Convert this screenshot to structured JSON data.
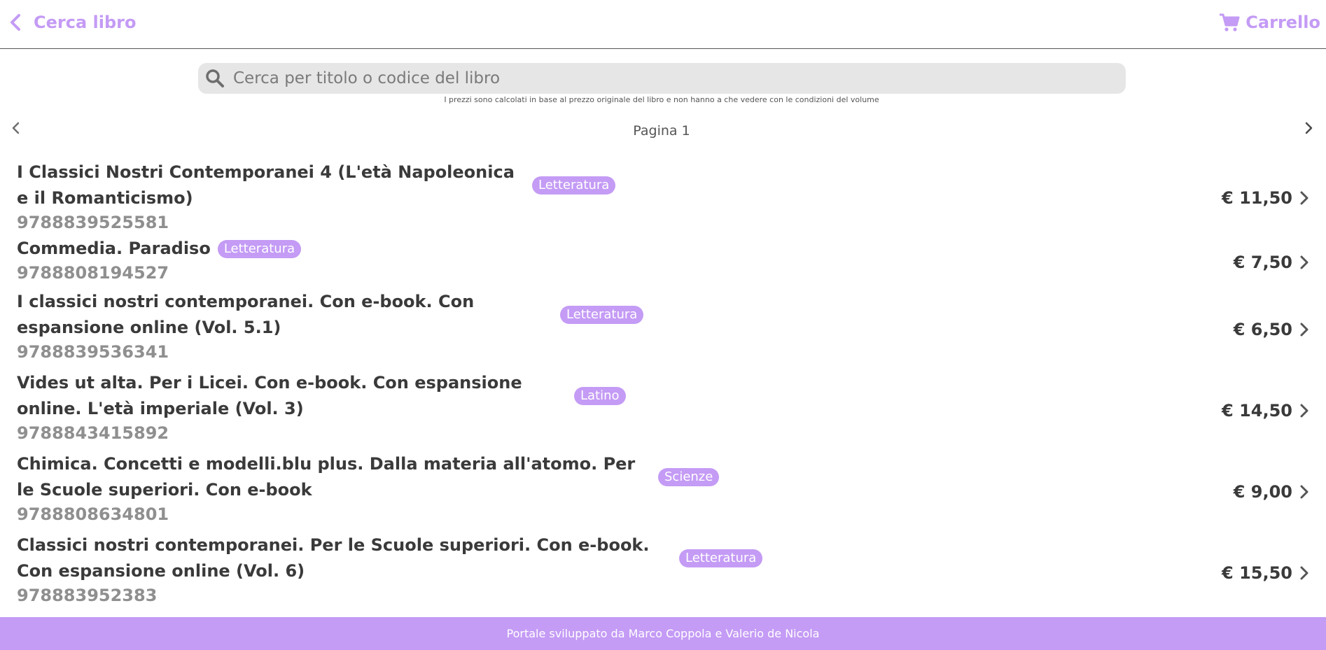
{
  "header": {
    "back_label": "Cerca libro",
    "back_icon": "chevron-left-icon",
    "cart_label": "Carrello",
    "cart_icon": "cart-icon"
  },
  "search": {
    "placeholder": "Cerca per titolo o codice del libro",
    "value": "",
    "note": "I prezzi sono calcolati in base al prezzo originale del libro e non hanno a che vedere con le condizioni del volume"
  },
  "pagination": {
    "label": "Pagina 1",
    "current_page": 1
  },
  "books": [
    {
      "title": "I Classici Nostri Contemporanei 4 (L'età Napoleonica e il Romanticismo)",
      "category": "Letteratura",
      "isbn": "9788839525581",
      "price": "€ 11,50"
    },
    {
      "title": "Commedia. Paradiso",
      "category": "Letteratura",
      "isbn": "9788808194527",
      "price": "€ 7,50"
    },
    {
      "title": "I classici nostri contemporanei. Con e-book. Con espansione online (Vol. 5.1)",
      "category": "Letteratura",
      "isbn": "9788839536341",
      "price": "€ 6,50"
    },
    {
      "title": "Vides ut alta. Per i Licei. Con e-book. Con espansione online. L'età imperiale (Vol. 3)",
      "category": "Latino",
      "isbn": "9788843415892",
      "price": "€ 14,50"
    },
    {
      "title": "Chimica. Concetti e modelli.blu plus. Dalla materia all'atomo. Per le Scuole superiori. Con e-book",
      "category": "Scienze",
      "isbn": "9788808634801",
      "price": "€ 9,00"
    },
    {
      "title": "Classici nostri contemporanei. Per le Scuole superiori. Con e-book. Con espansione online (Vol. 6)",
      "category": "Letteratura",
      "isbn": "978883952383",
      "price": "€ 15,50"
    }
  ],
  "footer": {
    "text": "Portale sviluppato da Marco Coppola e Valerio de Nicola"
  },
  "colors": {
    "accent": "#c49bf5",
    "text": "#3a3a3a",
    "muted": "#8f8f8f",
    "search_bg": "#e6e6e6"
  }
}
